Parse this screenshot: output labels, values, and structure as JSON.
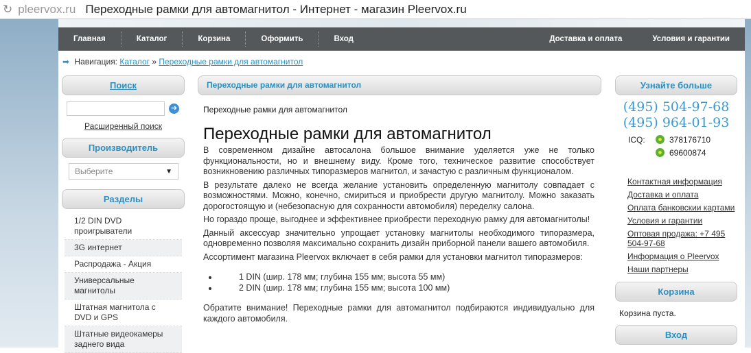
{
  "browser": {
    "domain": "pleervox.ru",
    "title": "Переходные рамки для автомагнитол - Интернет - магазин Pleervox.ru"
  },
  "nav": {
    "left": [
      "Главная",
      "Каталог",
      "Корзина",
      "Оформить",
      "Вход"
    ],
    "right": [
      "Доставка и оплата",
      "Условия и гарантии"
    ]
  },
  "breadcrumb": {
    "label": "Навигация:",
    "items": [
      "Каталог",
      "Переходные рамки для автомагнитол"
    ],
    "sep": "»"
  },
  "left": {
    "search_title": "Поиск",
    "search_value": "",
    "advanced": "Расширенный поиск",
    "maker_title": "Производитель",
    "maker_selected": "Выберите",
    "sections_title": "Разделы",
    "sections": [
      "1/2 DIN DVD проигрыватели",
      "3G интернет",
      "Распродажа - Акция",
      "Универсальные магнитолы",
      "Штатная магнитола с DVD и GPS",
      "Штатные видеокамеры заднего вида"
    ]
  },
  "main": {
    "box_title": "Переходные рамки для автомагнитол",
    "subtitle": "Переходные рамки для автомагнитол",
    "heading": "Переходные рамки для автомагнитол",
    "paragraphs": [
      "В современном дизайне автосалона большое внимание уделяется уже не только функциональности, но и внешнему виду. Кроме того, техническое развитие способствует возникновению различных типоразмеров магнитол, и зачастую с различным функционалом.",
      " В результате далеко не всегда желание установить определенную магнитолу совпадает с возможностями. Можно, конечно, смириться и приобрести другую магнитолу. Можно заказать дорогостоящую и (небезопасную для сохранности автомобиля) переделку салона.",
      "  Но гораздо проще, выгоднее и эффективнее приобрести переходную рамку для автомагнитолы!",
      "  Данный аксессуар значительно упрощает установку магнитолы необходимого типоразмера, одновременно позволяя максимально сохранить дизайн приборной панели вашего автомобиля.",
      " Ассортимент магазина Pleervox включает в себя рамки для установки магнитол типоразмеров:"
    ],
    "list": [
      "1 DIN (шир. 178 мм; глубина 155 мм; высота 55 мм)",
      "2 DIN (шир. 178 мм; глубина 155 мм; высота 100 мм)"
    ],
    "note": " Обратите внимание! Переходные рамки для автомагнитол подбираются индивидуально для каждого автомобиля."
  },
  "right": {
    "info_title": "Узнайте больше",
    "phones": [
      "(495) 504-97-68",
      "(495) 964-01-93"
    ],
    "icq_label": "ICQ:",
    "icq": [
      "378176710",
      "69600874"
    ],
    "links": [
      "Контактная информация",
      "Доставка и оплата",
      "Оплата банковскии картами",
      "Условия и гарантии",
      "Оптовая продажа: +7 495 504-97-68",
      "Информация о Pleervox",
      "Наши партнеры"
    ],
    "cart_title": "Корзина",
    "cart_msg": "Корзина пуста.",
    "login_title": "Вход"
  }
}
